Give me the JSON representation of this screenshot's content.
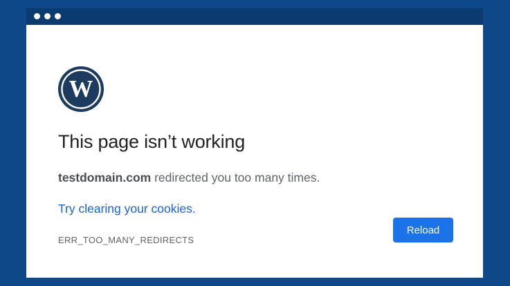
{
  "colors": {
    "background": "#0e4888",
    "titlebar": "#0b3a70",
    "window": "#ffffff",
    "logo": "#1d3b5e",
    "link": "#1a63d6",
    "button": "#1a73e8"
  },
  "titlebar": {
    "icons": [
      "window-dot-icon",
      "window-dot-icon",
      "window-dot-icon"
    ]
  },
  "logo": {
    "icon": "wordpress-logo-icon",
    "letter": "W"
  },
  "error": {
    "title": "This page isn’t working",
    "domain": "testdomain.com",
    "message_suffix": " redirected you too many times.",
    "suggestion": "Try clearing your cookies.",
    "code": "ERR_TOO_MANY_REDIRECTS"
  },
  "actions": {
    "reload_label": "Reload"
  }
}
